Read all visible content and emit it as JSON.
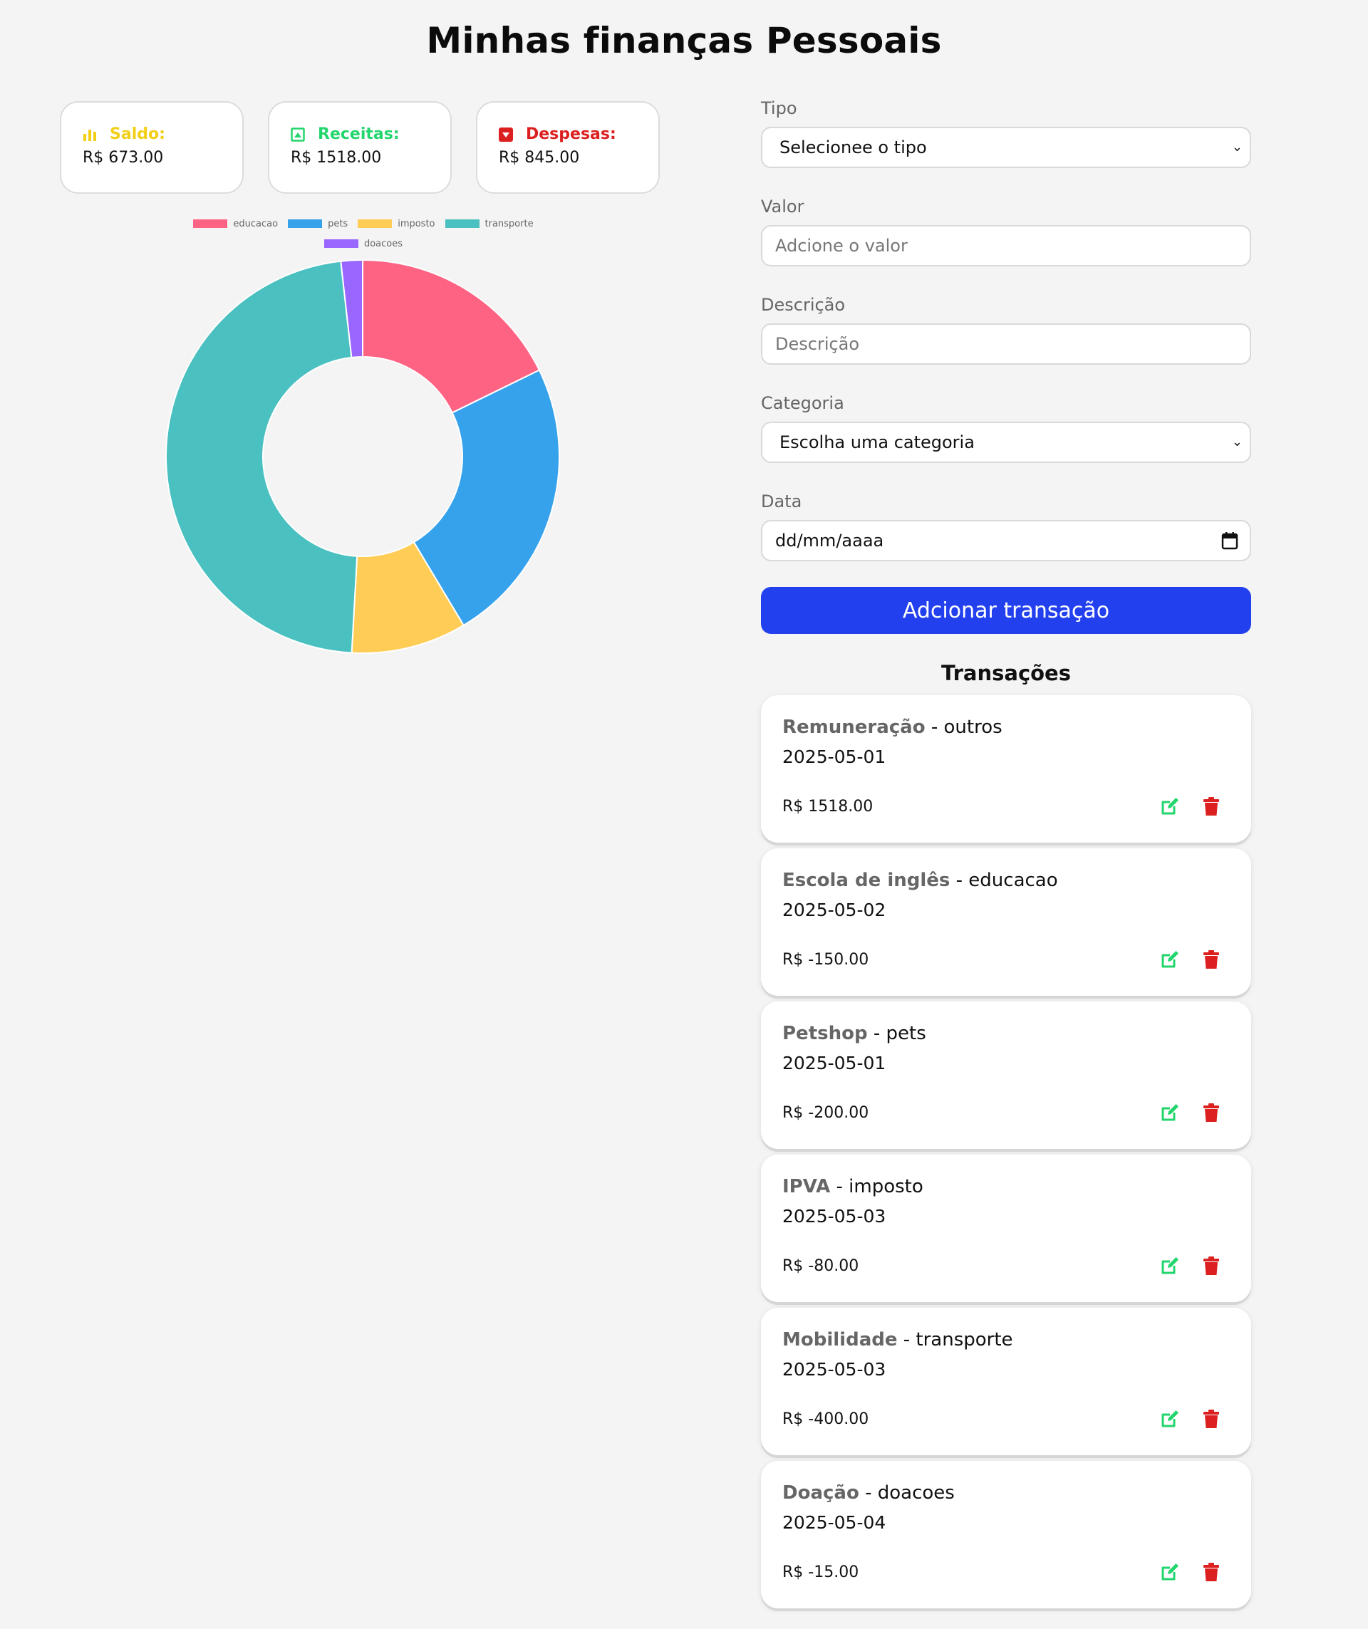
{
  "header": {
    "title": "Minhas finanças Pessoais"
  },
  "summary": {
    "saldo": {
      "label": "Saldo:",
      "value": "R$ 673.00",
      "color": "#f2cf16",
      "icon": "bar-chart-icon"
    },
    "receitas": {
      "label": "Receitas:",
      "value": "R$ 1518.00",
      "color": "#22d56c",
      "icon": "image-icon"
    },
    "despesas": {
      "label": "Despesas:",
      "value": "R$ 845.00",
      "color": "#dc2020",
      "icon": "arrow-down-square-icon"
    }
  },
  "chart_data": {
    "type": "pie",
    "variant": "doughnut",
    "categories": [
      "educacao",
      "pets",
      "imposto",
      "transporte",
      "doacoes"
    ],
    "values": [
      150,
      200,
      80,
      400,
      15
    ],
    "colors": [
      "#ff6384",
      "#36a2eb",
      "#ffcd56",
      "#4bc0c0",
      "#9966ff"
    ],
    "legend_position": "top"
  },
  "form": {
    "tipo": {
      "label": "Tipo",
      "selected": "Selecionee o tipo"
    },
    "valor": {
      "label": "Valor",
      "placeholder": "Adcione o valor"
    },
    "descricao": {
      "label": "Descrição",
      "placeholder": "Descrição"
    },
    "categoria": {
      "label": "Categoria",
      "selected": "Escolha uma categoria"
    },
    "data": {
      "label": "Data",
      "placeholder": "dd/mm/aaaa"
    },
    "submit_label": "Adcionar transação",
    "submit_color": "#2340ef"
  },
  "transactions": {
    "title": "Transações",
    "items": [
      {
        "name": "Remuneração",
        "category": "outros",
        "date": "2025-05-01",
        "amount": "R$ 1518.00"
      },
      {
        "name": "Escola de inglês",
        "category": "educacao",
        "date": "2025-05-02",
        "amount": "R$ -150.00"
      },
      {
        "name": "Petshop",
        "category": "pets",
        "date": "2025-05-01",
        "amount": "R$ -200.00"
      },
      {
        "name": "IPVA",
        "category": "imposto",
        "date": "2025-05-03",
        "amount": "R$ -80.00"
      },
      {
        "name": "Mobilidade",
        "category": "transporte",
        "date": "2025-05-03",
        "amount": "R$ -400.00"
      },
      {
        "name": "Doação",
        "category": "doacoes",
        "date": "2025-05-04",
        "amount": "R$ -15.00"
      }
    ],
    "edit_icon_color": "#22d56c",
    "delete_icon_color": "#dc2020"
  }
}
